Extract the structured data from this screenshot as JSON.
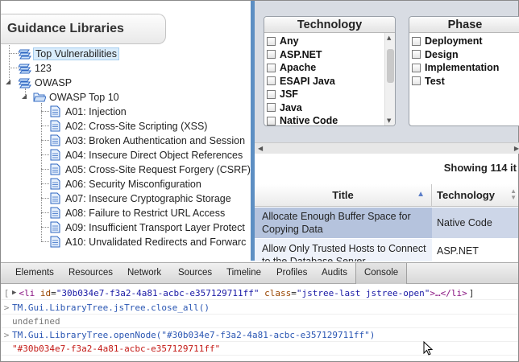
{
  "guidance_header": "Guidance Libraries",
  "tree": {
    "root_items": [
      "Top Vulnerabilities",
      "123",
      "OWASP"
    ],
    "folder": "OWASP Top 10",
    "children": [
      "A01: Injection",
      "A02: Cross-Site Scripting (XSS)",
      "A03: Broken Authentication and Session",
      "A04: Insecure Direct Object References",
      "A05: Cross-Site Request Forgery (CSRF)",
      "A06: Security Misconfiguration",
      "A07: Insecure Cryptographic Storage",
      "A08: Failure to Restrict URL Access",
      "A09: Insufficient Transport Layer Protect",
      "A10: Unvalidated Redirects and Forwarc"
    ]
  },
  "filters": {
    "technology": {
      "title": "Technology",
      "items": [
        "Any",
        "ASP.NET",
        "Apache",
        "ESAPI Java",
        "JSF",
        "Java",
        "Native Code"
      ]
    },
    "phase": {
      "title": "Phase",
      "items": [
        "Deployment",
        "Design",
        "Implementation",
        "Test"
      ]
    }
  },
  "results": {
    "showing": "Showing 114 it",
    "columns": [
      "Title",
      "Technology"
    ],
    "rows": [
      {
        "title": "Allocate Enough Buffer Space for Copying Data",
        "technology": "Native Code"
      },
      {
        "title": "Allow Only Trusted Hosts to Connect to the Database Server",
        "technology": "ASP.NET"
      }
    ]
  },
  "devtools": {
    "tabs": [
      "Elements",
      "Resources",
      "Network",
      "Sources",
      "Timeline",
      "Profiles",
      "Audits",
      "Console"
    ],
    "active_tab": "Console",
    "console": {
      "line1_open": "<li",
      "line1_attr1": "id",
      "line1_val1": "\"30b034e7-f3a2-4a81-acbc-e357129711ff\"",
      "line1_attr2": "class",
      "line1_val2": "\"jstree-last jstree-open\"",
      "line1_close": ">…</li>",
      "cmd1": "TM.Gui.LibraryTree.jsTree.close_all()",
      "out1": "undefined",
      "cmd2": "TM.Gui.LibraryTree.openNode(\"#30b034e7-f3a2-4a81-acbc-e357129711ff\")",
      "out2": "\"#30b034e7-f3a2-4a81-acbc-e357129711ff\""
    }
  },
  "colors": {
    "accent_blue": "#5d8fc3",
    "selected_row": "#b5c3dd",
    "alt_row": "#eef2fa",
    "tree_highlight": "#d9ecfb"
  }
}
